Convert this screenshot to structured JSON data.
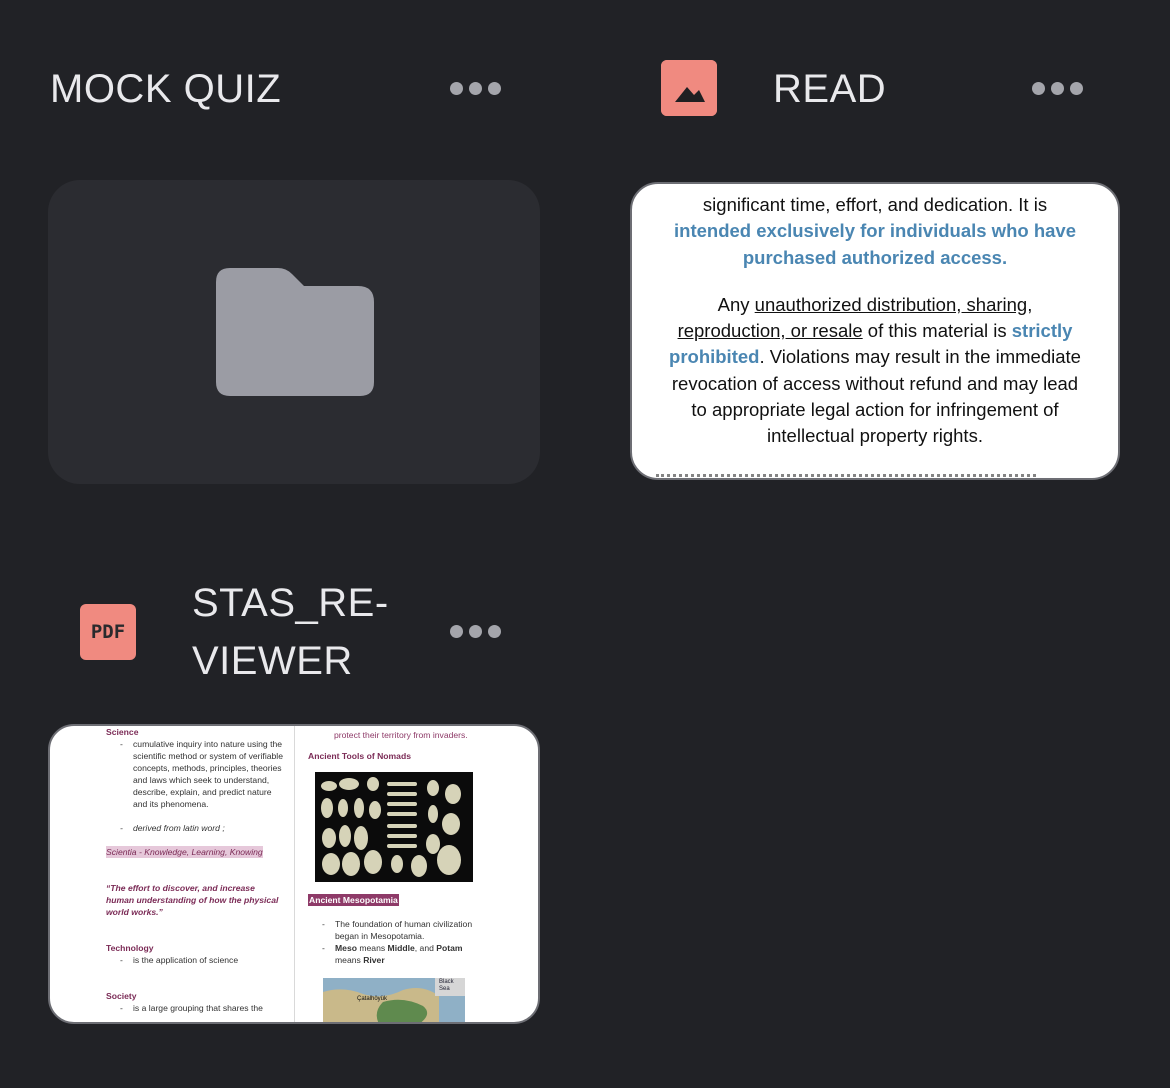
{
  "items": [
    {
      "title": "MOCK QUIZ",
      "kind": "folder",
      "icon": "folder-icon"
    },
    {
      "title": "READ",
      "kind": "image",
      "icon": "image-icon"
    },
    {
      "title_line1": "STAS_RE-",
      "title_line2": "VIEWER",
      "kind": "pdf",
      "icon": "pdf-icon",
      "badge_text": "PDF"
    }
  ],
  "read_preview": {
    "line1": "significant time, effort, and dedication. It is",
    "line2": "intended exclusively for individuals who have",
    "line3": "purchased authorized access.",
    "p2_a": "Any ",
    "p2_b": "unauthorized distribution, sharing,",
    "p2_c": "reproduction, or resale",
    "p2_d": " of this material is ",
    "p2_e": "strictly",
    "p2_f": "prohibited",
    "p2_g": ". Violations may result in the immediate",
    "p2_h": "revocation of access without refund and may lead",
    "p2_i": "to appropriate legal action for infringement of",
    "p2_j": "intellectual property rights."
  },
  "pdf_preview": {
    "left": {
      "science_head": "Science",
      "science_b1": "cumulative inquiry into nature using the scientific method or system of verifiable concepts, methods, principles, theories and laws which seek to understand, describe, explain, and predict nature and its phenomena.",
      "science_b2": "derived from latin word ;",
      "scientia": "Scientia - Knowledge, Learning, Knowing",
      "quote": "“The effort to discover, and increase human understanding of how the physical world works.”",
      "tech_head": "Technology",
      "tech_b1": "is the application of science",
      "society_head": "Society",
      "society_b1": "is a large grouping that shares the"
    },
    "right": {
      "top_line": "protect their territory from invaders.",
      "tools_head": "Ancient Tools of Nomads",
      "meso_head": "Ancient Mesopotamia",
      "meso_b1": "The foundation of human civilization began in Mesopotamia.",
      "meso_b2_a": "Meso",
      "meso_b2_b": " means ",
      "meso_b2_c": "Middle",
      "meso_b2_d": ", and ",
      "meso_b2_e": "Potam",
      "meso_b2_f": " means ",
      "meso_b2_g": "River",
      "map_label": "Black Sea",
      "map_city": "Çatalhöyük"
    }
  },
  "colors": {
    "background": "#212226",
    "badge": "#f08a80",
    "folder": "#9b9ca4",
    "accent_blue": "#4a86b2"
  }
}
